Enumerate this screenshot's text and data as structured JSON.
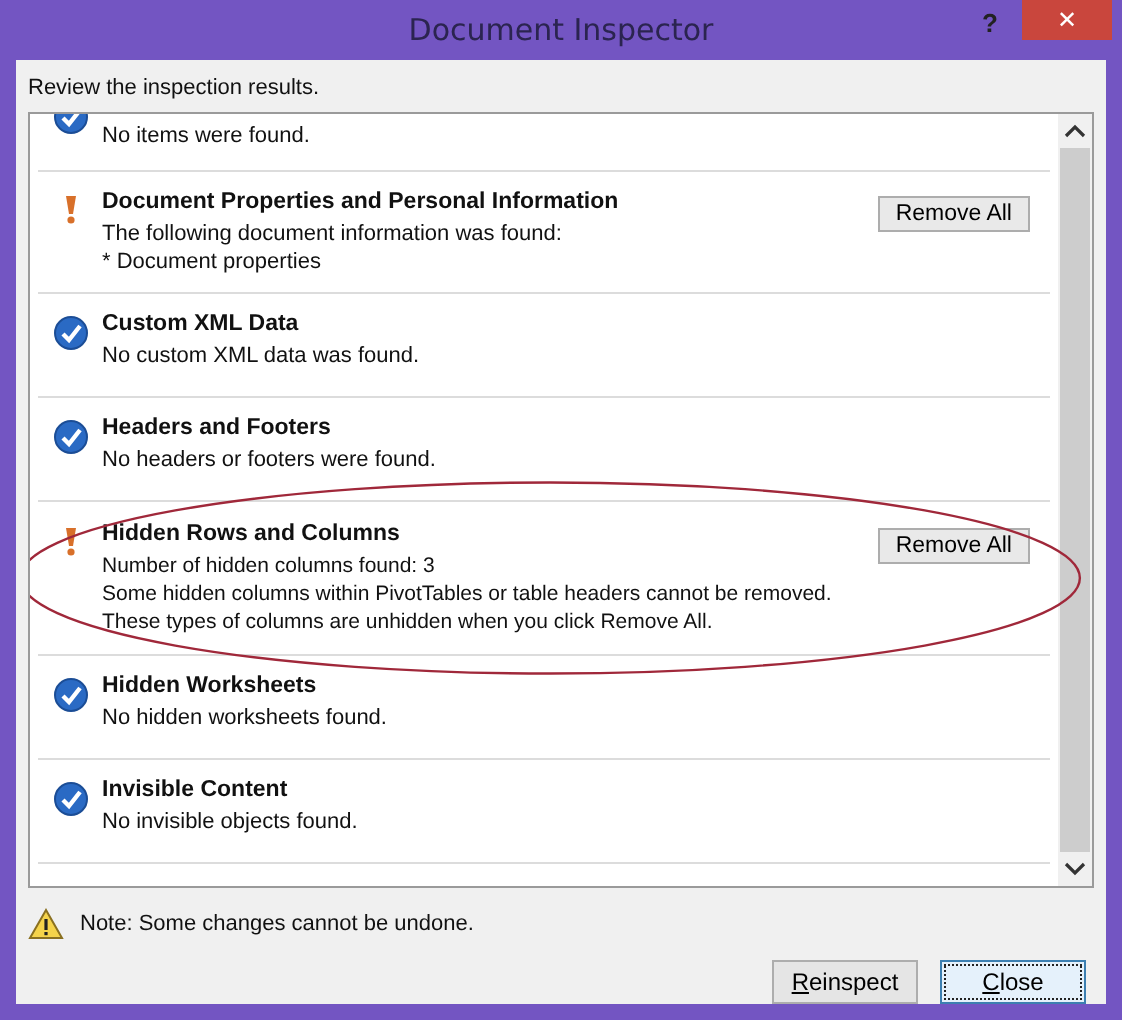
{
  "window": {
    "title": "Document Inspector",
    "help_label": "?",
    "close_label": "✕"
  },
  "intro": "Review the inspection results.",
  "items": [
    {
      "kind": "ok",
      "details": [
        "No items were found."
      ],
      "highlighted": false
    },
    {
      "kind": "found",
      "title": "Document Properties and Personal Information",
      "details": [
        "The following document information was found:",
        "* Document properties"
      ],
      "action": "Remove All",
      "highlighted": false
    },
    {
      "kind": "ok",
      "title": "Custom XML Data",
      "details": [
        "No custom XML data was found."
      ],
      "highlighted": false
    },
    {
      "kind": "ok",
      "title": "Headers and Footers",
      "details": [
        "No headers or footers were found."
      ],
      "highlighted": false
    },
    {
      "kind": "found",
      "title": "Hidden Rows and Columns",
      "details": [
        "Number of hidden columns found: 3",
        "Some hidden columns within PivotTables or table headers cannot be removed.",
        "These types of columns are unhidden when you click Remove All."
      ],
      "action": "Remove All",
      "highlighted": true
    },
    {
      "kind": "ok",
      "title": "Hidden Worksheets",
      "details": [
        "No hidden worksheets found."
      ],
      "highlighted": false
    },
    {
      "kind": "ok",
      "title": "Invisible Content",
      "details": [
        "No invisible objects found."
      ],
      "highlighted": false
    }
  ],
  "note": "Note: Some changes cannot be undone.",
  "buttons": [
    {
      "label": "Reinspect",
      "focused": false
    },
    {
      "label": "Close",
      "focused": true
    }
  ]
}
